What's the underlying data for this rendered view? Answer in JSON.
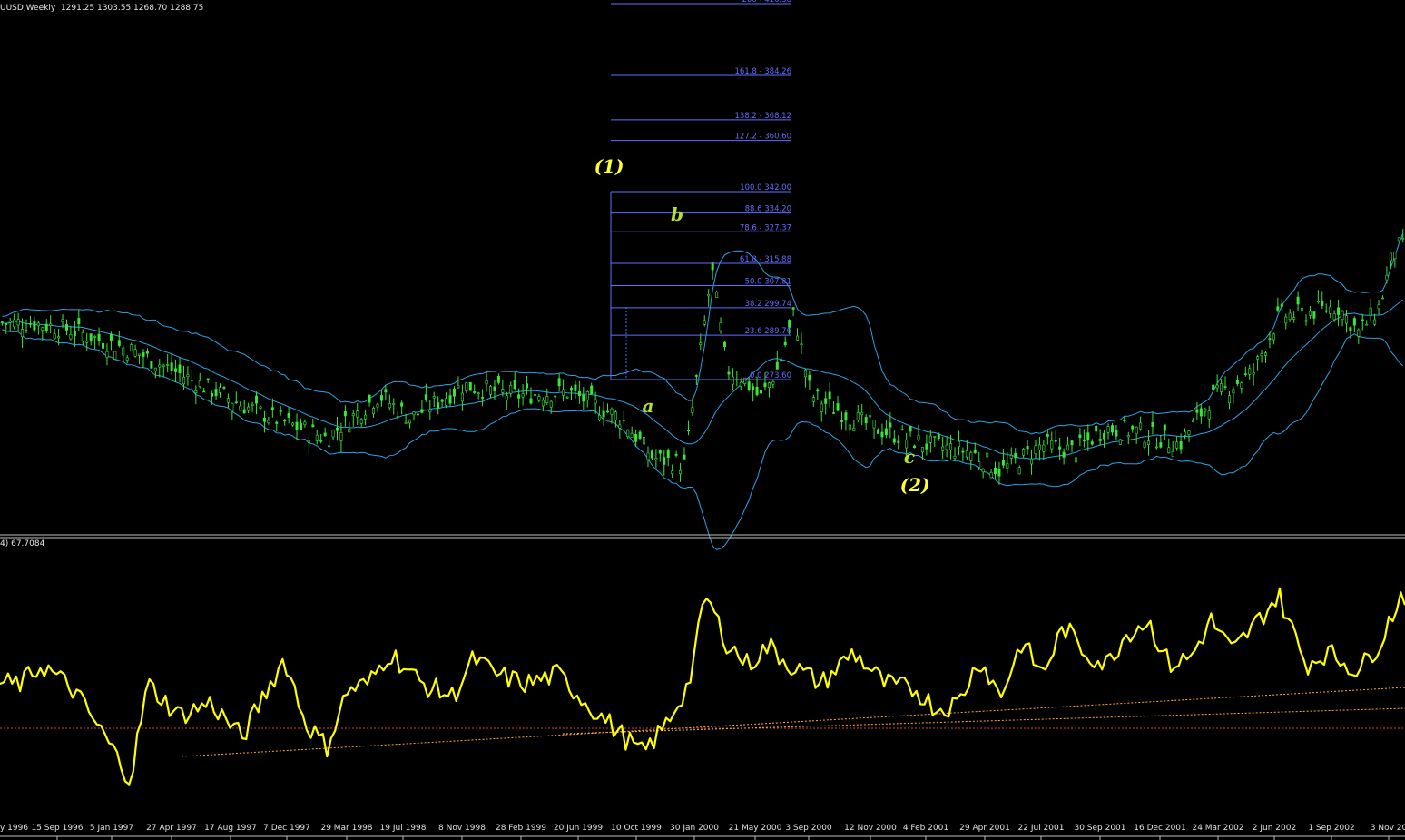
{
  "main_header": "UUSD,Weekly  1291.25 1303.55 1268.70 1288.75",
  "osc_header": "4) 67.7084",
  "colors": {
    "background": "#000000",
    "candles": "#39e639",
    "bands": "#2aa3e6",
    "fib": "#6070ff",
    "fib_label": "#6a6aff",
    "oscillator": "#ffff00",
    "trendline": "#ffaa33",
    "level_line": "#d04040",
    "wave_yellow": "#ffff33",
    "wave_green": "#b6e033",
    "separator": "#c0c0c0",
    "axis_text": "#e0e0e0"
  },
  "chart_data": [
    {
      "type": "candlestick",
      "period": "Weekly",
      "indicator": "Bollinger Bands",
      "fib_levels": [
        {
          "label": "200 - 410.38",
          "pct": 200,
          "value": 410.38
        },
        {
          "label": "161.8 - 384.26",
          "pct": 161.8,
          "value": 384.26
        },
        {
          "label": "138.2 - 368.12",
          "pct": 138.2,
          "value": 368.12
        },
        {
          "label": "127.2 - 360.60",
          "pct": 127.2,
          "value": 360.6
        },
        {
          "label": "100.0 342.00",
          "pct": 100,
          "value": 342.0
        },
        {
          "label": "88.6 334.20",
          "pct": 88.6,
          "value": 334.2
        },
        {
          "label": "78.6 - 327.37",
          "pct": 78.6,
          "value": 327.37
        },
        {
          "label": "61.8 - 315.88",
          "pct": 61.8,
          "value": 315.88
        },
        {
          "label": "50.0 307.81",
          "pct": 50,
          "value": 307.81
        },
        {
          "label": "38.2 299.74",
          "pct": 38.2,
          "value": 299.74
        },
        {
          "label": "23.6 289.76",
          "pct": 23.6,
          "value": 289.76
        },
        {
          "label": "0.0 273.60",
          "pct": 0,
          "value": 273.6
        }
      ],
      "wave_labels": [
        {
          "text": "(1)",
          "style": "yellow"
        },
        {
          "text": "b",
          "style": "green"
        },
        {
          "text": "a",
          "style": "green"
        },
        {
          "text": "c",
          "style": "green"
        },
        {
          "text": "(2)",
          "style": "yellow"
        }
      ],
      "price_series": [
        [
          1996.5,
          315
        ],
        [
          1996.68,
          313
        ],
        [
          1997.0,
          306
        ],
        [
          1997.25,
          298
        ],
        [
          1997.5,
          290
        ],
        [
          1997.65,
          286
        ],
        [
          1997.9,
          280
        ],
        [
          1998.15,
          293
        ],
        [
          1998.3,
          286
        ],
        [
          1998.55,
          296
        ],
        [
          1998.8,
          293
        ],
        [
          1999.05,
          294
        ],
        [
          1999.3,
          286
        ],
        [
          1999.45,
          274
        ],
        [
          1999.6,
          272
        ],
        [
          1999.73,
          331
        ],
        [
          1999.8,
          301
        ],
        [
          1999.88,
          298
        ],
        [
          1999.96,
          292
        ],
        [
          2000.05,
          302
        ],
        [
          2000.12,
          318
        ],
        [
          2000.2,
          293
        ],
        [
          2000.4,
          286
        ],
        [
          2000.55,
          282
        ],
        [
          2000.75,
          278
        ],
        [
          2000.95,
          276
        ],
        [
          2001.1,
          270
        ],
        [
          2001.3,
          278
        ],
        [
          2001.45,
          276
        ],
        [
          2001.6,
          283
        ],
        [
          2001.75,
          282
        ],
        [
          2001.95,
          278
        ],
        [
          2002.1,
          292
        ],
        [
          2002.3,
          300
        ],
        [
          2002.42,
          317
        ],
        [
          2002.55,
          318
        ],
        [
          2002.7,
          320
        ],
        [
          2002.8,
          312
        ],
        [
          2002.9,
          320
        ],
        [
          2002.97,
          338
        ]
      ],
      "x_ticks": [
        "15 Sep 1996",
        "5 Jan 1997",
        "27 Apr 1997",
        "17 Aug 1997",
        "7 Dec 1997",
        "29 Mar 1998",
        "19 Jul 1998",
        "8 Nov 1998",
        "28 Feb 1999",
        "20 Jun 1999",
        "10 Oct 1999",
        "30 Jan 2000",
        "21 May 2000",
        "3 Sep 2000",
        "12 Nov 2000",
        "4 Feb 2001",
        "29 Apr 2001",
        "22 Jul 2001",
        "30 Sep 2001",
        "16 Dec 2001",
        "24 Mar 2002",
        "2 Jun 2002",
        "1 Sep 2002",
        "3 Nov 20"
      ],
      "x_tick_truncated_left": "y 1996"
    },
    {
      "type": "line",
      "indicator_value_shown": 67.7084,
      "series": [
        {
          "values": [
            [
              1996.45,
              52
            ],
            [
              1996.55,
              58
            ],
            [
              1996.7,
              50
            ],
            [
              1996.85,
              35
            ],
            [
              1996.97,
              22
            ],
            [
              1997.05,
              52
            ],
            [
              1997.2,
              42
            ],
            [
              1997.35,
              46
            ],
            [
              1997.5,
              35
            ],
            [
              1997.6,
              48
            ],
            [
              1997.7,
              60
            ],
            [
              1997.8,
              40
            ],
            [
              1997.9,
              32
            ],
            [
              1998.0,
              50
            ],
            [
              1998.1,
              52
            ],
            [
              1998.2,
              62
            ],
            [
              1998.35,
              52
            ],
            [
              1998.5,
              48
            ],
            [
              1998.6,
              60
            ],
            [
              1998.7,
              55
            ],
            [
              1998.85,
              52
            ],
            [
              1999.0,
              55
            ],
            [
              1999.15,
              45
            ],
            [
              1999.3,
              36
            ],
            [
              1999.4,
              30
            ],
            [
              1999.5,
              38
            ],
            [
              1999.62,
              52
            ],
            [
              1999.7,
              80
            ],
            [
              1999.8,
              65
            ],
            [
              1999.9,
              58
            ],
            [
              2000.0,
              64
            ],
            [
              2000.1,
              58
            ],
            [
              2000.25,
              52
            ],
            [
              2000.4,
              62
            ],
            [
              2000.55,
              52
            ],
            [
              2000.7,
              50
            ],
            [
              2000.8,
              44
            ],
            [
              2000.9,
              46
            ],
            [
              2001.0,
              60
            ],
            [
              2001.1,
              48
            ],
            [
              2001.2,
              65
            ],
            [
              2001.3,
              55
            ],
            [
              2001.4,
              70
            ],
            [
              2001.5,
              62
            ],
            [
              2001.6,
              58
            ],
            [
              2001.7,
              68
            ],
            [
              2001.8,
              72
            ],
            [
              2001.9,
              58
            ],
            [
              2002.0,
              60
            ],
            [
              2002.1,
              72
            ],
            [
              2002.2,
              62
            ],
            [
              2002.3,
              70
            ],
            [
              2002.42,
              80
            ],
            [
              2002.55,
              58
            ],
            [
              2002.65,
              62
            ],
            [
              2002.8,
              56
            ],
            [
              2002.9,
              65
            ],
            [
              2003.0,
              80
            ]
          ]
        }
      ]
    }
  ]
}
